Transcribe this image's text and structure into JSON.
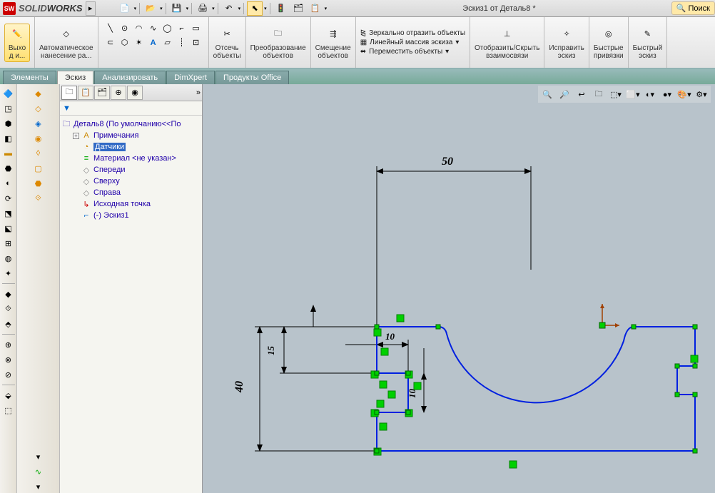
{
  "app": {
    "name_prefix": "SOLID",
    "name_suffix": "WORKS",
    "doc_title": "Эскиз1 от Деталь8 *",
    "search": "Поиск"
  },
  "ribbon": {
    "exit": "Выхо\nд и...",
    "autodim": "Автоматическое\nнанесение ра...",
    "trim": "Отсечь\nобъекты",
    "convert": "Преобразование\nобъектов",
    "offset": "Смещение\nобъектов",
    "mirror": "Зеркально отразить объекты",
    "linpattern": "Линейный массив эскиза",
    "move": "Переместить объекты",
    "showhide": "Отобразить/Скрыть\nвзаимосвязи",
    "repair": "Исправить\nэскиз",
    "quicksnap": "Быстрые\nпривязки",
    "quicksketch": "Быстрый\nэскиз"
  },
  "tabs": [
    "Элементы",
    "Эскиз",
    "Анализировать",
    "DimXpert",
    "Продукты Office"
  ],
  "tree": {
    "root": "Деталь8  (По умолчанию<<По",
    "items": [
      "Примечания",
      "Датчики",
      "Материал <не указан>",
      "Спереди",
      "Сверху",
      "Справа",
      "Исходная точка",
      "(-) Эскиз1"
    ]
  },
  "dims": {
    "d50": "50",
    "d40": "40",
    "d15": "15",
    "d10a": "10",
    "d10b": "10"
  }
}
